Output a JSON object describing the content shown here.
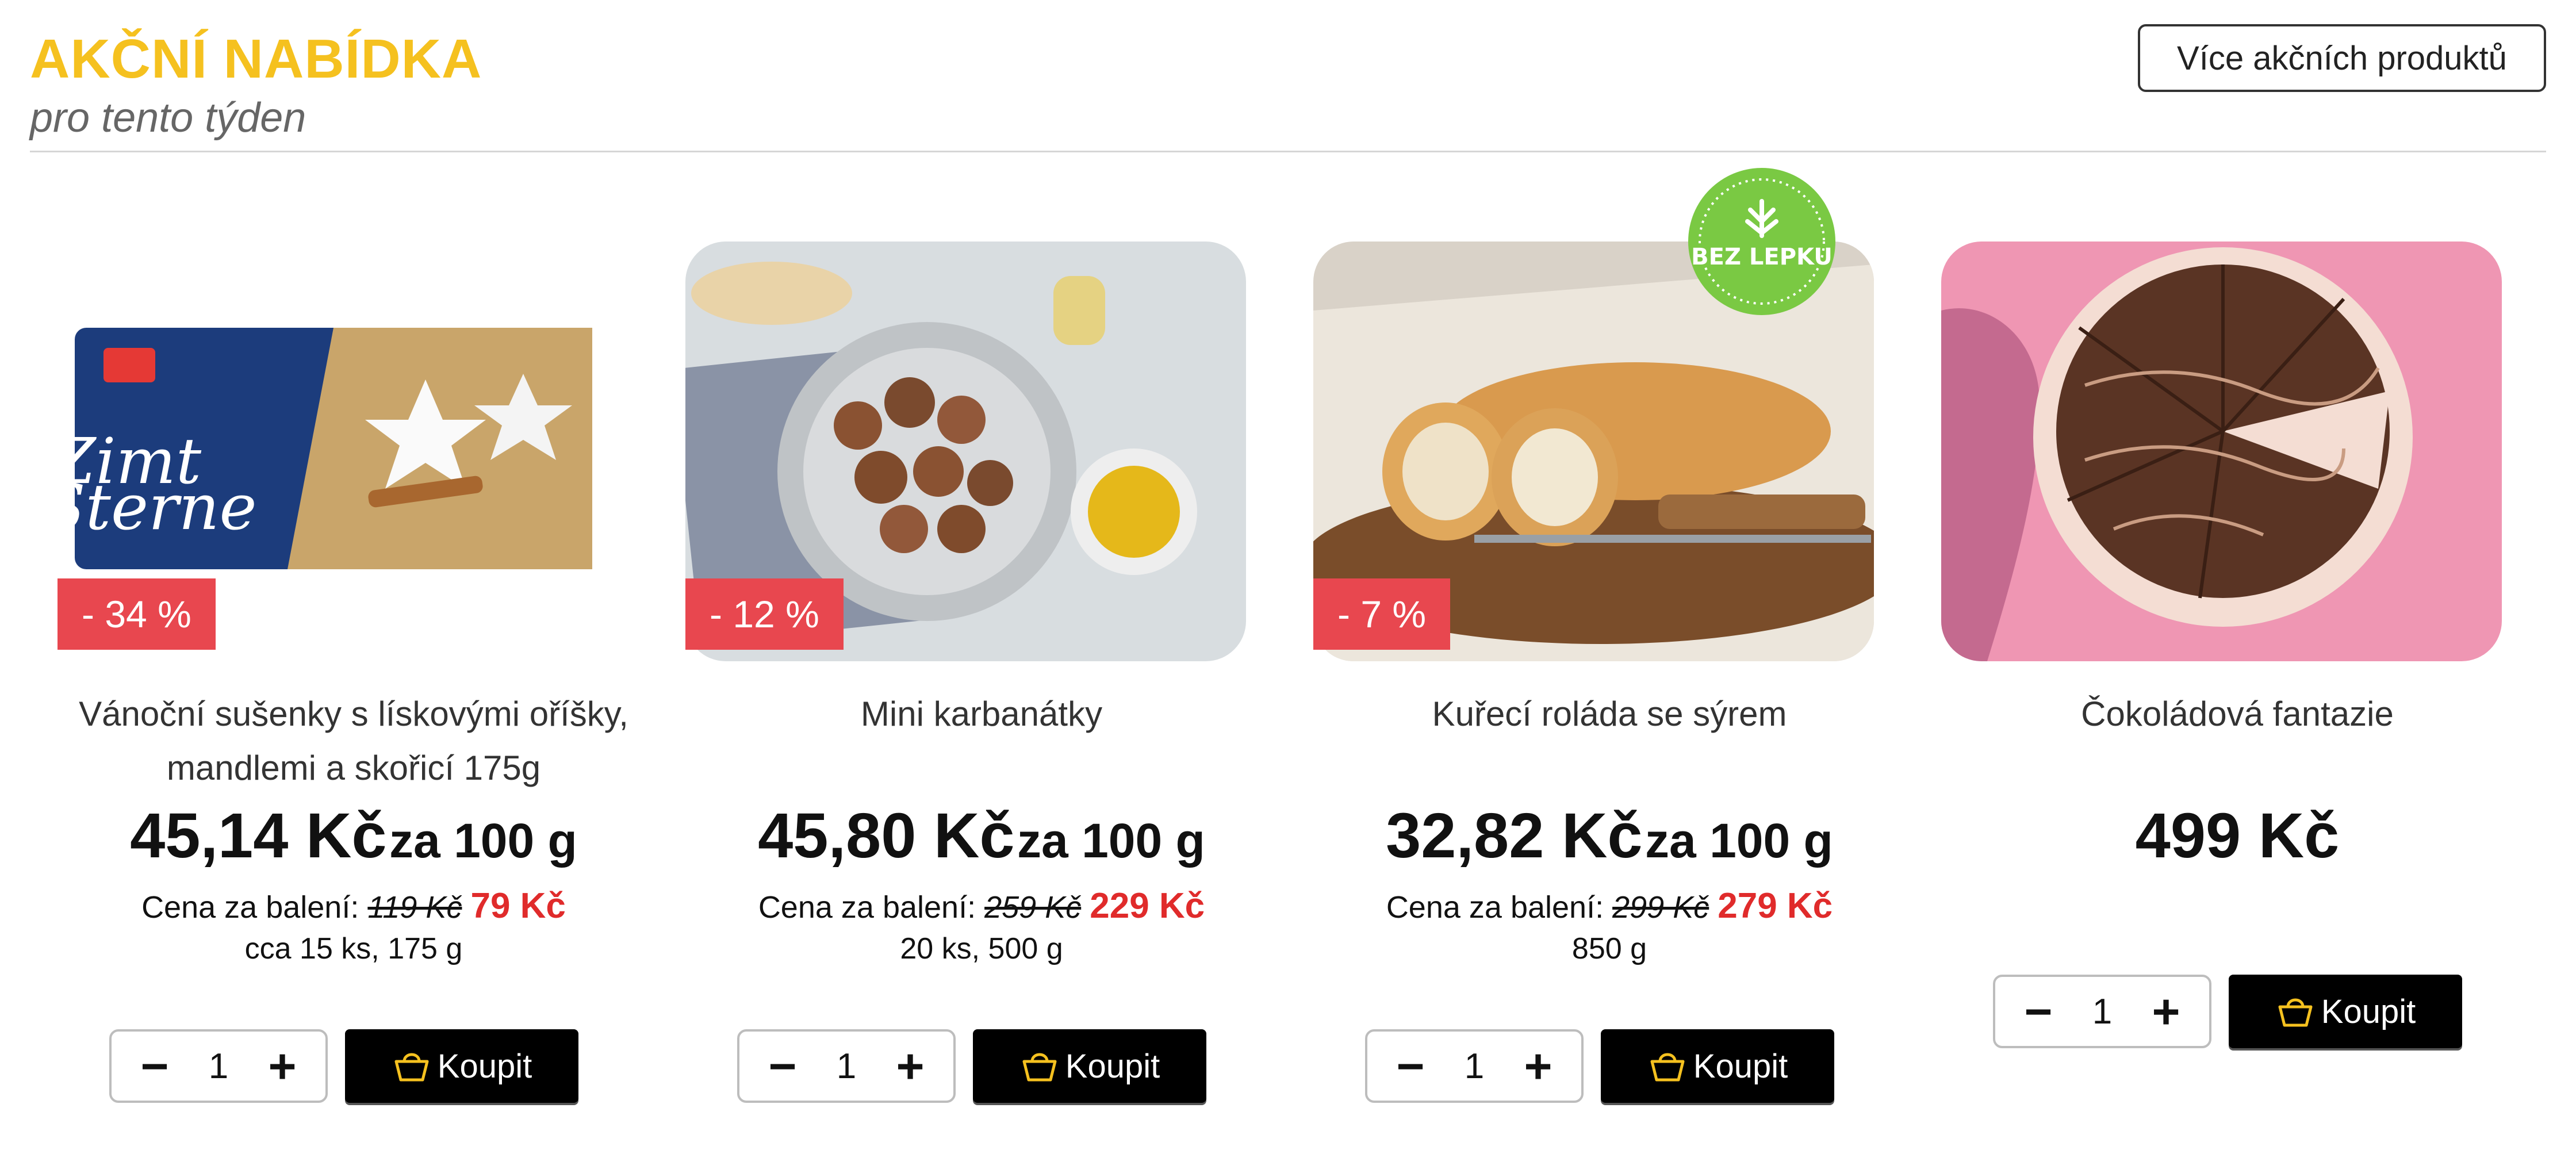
{
  "header": {
    "title": "AKČNÍ NABÍDKA",
    "subtitle": "pro tento týden",
    "more_button": "Více akčních produktů"
  },
  "products": [
    {
      "name": "Vánoční sušenky s lískovými oříšky, mandlemi a skořicí 175g",
      "badge": "- 34 %",
      "price_big": "45,14 Kč",
      "price_unit": "za 100 g",
      "pack_label": "Cena za balení:",
      "old_price": "119 Kč",
      "new_price": "79 Kč",
      "quantity_info": "cca 15 ks, 175 g",
      "qty": "1",
      "buy_label": "Koupit",
      "image_icon": "cinnamon-star-cookies-package-image"
    },
    {
      "name": "Mini karbanátky",
      "badge": "- 12 %",
      "price_big": "45,80 Kč",
      "price_unit": "za 100 g",
      "pack_label": "Cena za balení:",
      "old_price": "259 Kč",
      "new_price": "229 Kč",
      "quantity_info": "20 ks, 500 g",
      "qty": "1",
      "buy_label": "Koupit",
      "image_icon": "meatballs-image"
    },
    {
      "name": "Kuřecí roláda se sýrem",
      "badge": "- 7 %",
      "gluten_badge": "BEZ LEPKU",
      "price_big": "32,82 Kč",
      "price_unit": "za 100 g",
      "pack_label": "Cena za balení:",
      "old_price": "299 Kč",
      "new_price": "279 Kč",
      "quantity_info": "850 g",
      "qty": "1",
      "buy_label": "Koupit",
      "image_icon": "chicken-roll-image"
    },
    {
      "name": "Čokoládová fantazie",
      "price_big": "499 Kč",
      "qty": "1",
      "buy_label": "Koupit",
      "image_icon": "chocolate-cake-image"
    }
  ],
  "colors": {
    "title": "#f5c11f",
    "badge": "#e8474f",
    "new_price": "#e02b2b",
    "buy_button": "#000000",
    "basket_icon": "#f5c11f"
  },
  "icons": {
    "minus": "minus-icon",
    "plus": "plus-icon",
    "basket": "basket-icon"
  }
}
